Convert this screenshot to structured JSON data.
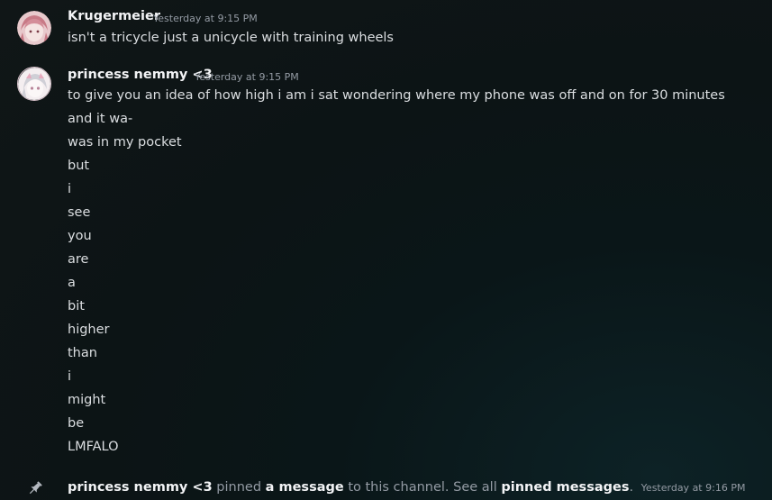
{
  "messages": [
    {
      "username": "Krugermeier",
      "timestamp": "Yesterday at 9:15 PM",
      "lines": [
        "isn't a tricycle just a unicycle with training wheels"
      ]
    },
    {
      "username": "princess nemmy <3",
      "timestamp": "Yesterday at 9:15 PM",
      "lines": [
        "to give you an idea of how high i am i sat wondering where my phone was off and on for 30 minutes",
        "and it wa-",
        "was in my pocket",
        "but",
        "i",
        "see",
        "you",
        "are",
        "a",
        "bit",
        "higher",
        "than",
        "i",
        "might",
        "be",
        "LMFALO"
      ]
    }
  ],
  "system": {
    "icon": "pin-icon",
    "actor": "princess nemmy <3",
    "verb": "pinned",
    "link1": "a message",
    "middle": "to this channel. See all",
    "link2": "pinned messages",
    "period": ".",
    "timestamp": "Yesterday at 9:16 PM"
  },
  "colors": {
    "username": "#f2f3f5",
    "text": "#dbdee1",
    "muted": "#949ba4"
  }
}
